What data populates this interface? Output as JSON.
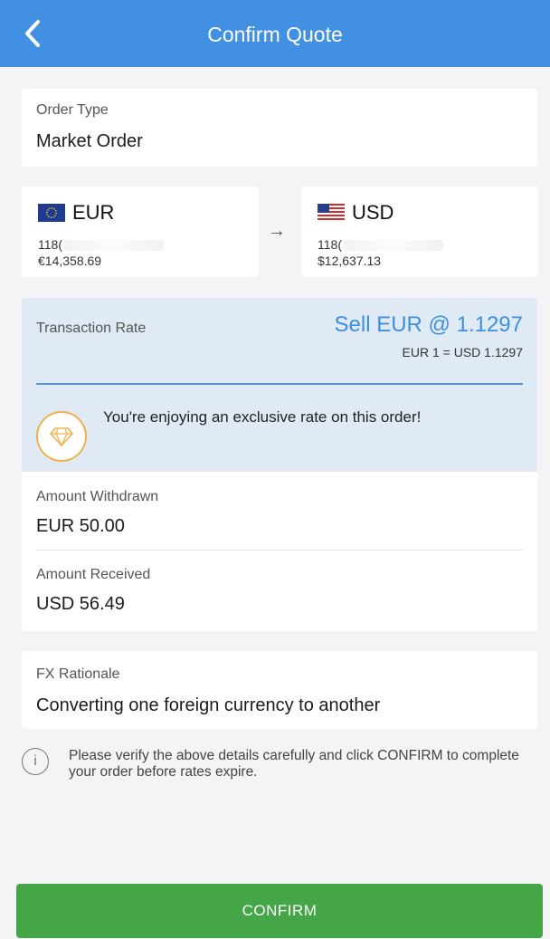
{
  "header": {
    "title": "Confirm Quote",
    "back_icon": "chevron-left-icon"
  },
  "order_type": {
    "label": "Order Type",
    "value": "Market Order"
  },
  "from_account": {
    "flag": "eu-flag-icon",
    "currency": "EUR",
    "account_prefix": "118(",
    "balance": "€14,358.69"
  },
  "to_account": {
    "flag": "us-flag-icon",
    "currency": "USD",
    "account_prefix": "118(",
    "balance": "$12,637.13"
  },
  "arrow": "→",
  "rate": {
    "label": "Transaction Rate",
    "main": "Sell EUR @ 1.1297",
    "sub": "EUR 1 = USD 1.1297",
    "badge_icon": "diamond-icon",
    "exclusive_text": "You're enjoying an exclusive rate on this order!"
  },
  "amounts": {
    "withdrawn_label": "Amount Withdrawn",
    "withdrawn_value": "EUR 50.00",
    "received_label": "Amount Received",
    "received_value": "USD 56.49"
  },
  "rationale": {
    "label": "FX Rationale",
    "value": "Converting one foreign currency to another"
  },
  "info": {
    "icon": "info-icon",
    "text": "Please verify the above details carefully and click CONFIRM to complete your order before rates expire."
  },
  "confirm_label": "CONFIRM",
  "colors": {
    "header": "#4190e2",
    "accent": "#3d8fe0",
    "confirm": "#45a647",
    "badge": "#efb24a"
  }
}
